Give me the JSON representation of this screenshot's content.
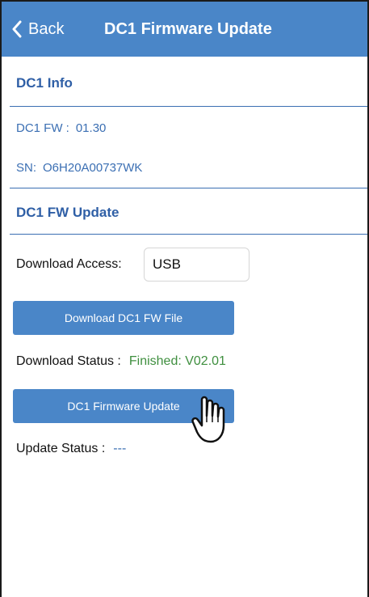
{
  "nav": {
    "back_label": "Back",
    "title": "DC1 Firmware Update"
  },
  "info": {
    "section_title": "DC1 Info",
    "fw_label": "DC1 FW :",
    "fw_value": "01.30",
    "sn_label": "SN:",
    "sn_value": "O6H20A00737WK"
  },
  "update": {
    "section_title": "DC1 FW Update",
    "download_access_label": "Download Access:",
    "download_access_value": "USB",
    "download_button": "Download DC1 FW File",
    "download_status_label": "Download Status :",
    "download_status_value": "Finished: V02.01",
    "update_button": "DC1 Firmware Update",
    "update_status_label": "Update Status :",
    "update_status_value": "---"
  },
  "icons": {
    "back": "chevron-left-icon",
    "pointer": "hand-pointer-icon"
  },
  "colors": {
    "navbar": "#4a86c8",
    "section_text": "#2f5fa6",
    "success": "#3f8f3f",
    "link_blue": "#3b6fb3"
  }
}
